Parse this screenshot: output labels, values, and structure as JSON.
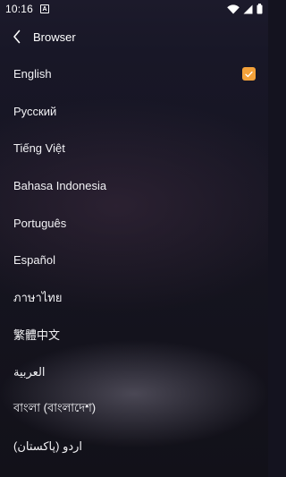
{
  "status_bar": {
    "time": "10:16",
    "notification_icon": "a-badge-icon",
    "icons": [
      "wifi-icon",
      "signal-icon",
      "battery-icon"
    ]
  },
  "header": {
    "title": "Browser",
    "back_icon": "chevron-left-icon"
  },
  "languages": [
    {
      "label": "English",
      "selected": true
    },
    {
      "label": "Русский",
      "selected": false
    },
    {
      "label": "Tiếng Việt",
      "selected": false
    },
    {
      "label": "Bahasa Indonesia",
      "selected": false
    },
    {
      "label": "Português",
      "selected": false
    },
    {
      "label": "Español",
      "selected": false
    },
    {
      "label": "ภาษาไทย",
      "selected": false
    },
    {
      "label": "繁體中文",
      "selected": false
    },
    {
      "label": "العربية",
      "selected": false
    },
    {
      "label": "বাংলা (বাংলাদেশ)",
      "selected": false
    },
    {
      "label": "اردو (پاکستان)",
      "selected": false
    }
  ],
  "colors": {
    "accent": "#f4a23a",
    "background": "#15141f",
    "text": "#ffffff"
  }
}
